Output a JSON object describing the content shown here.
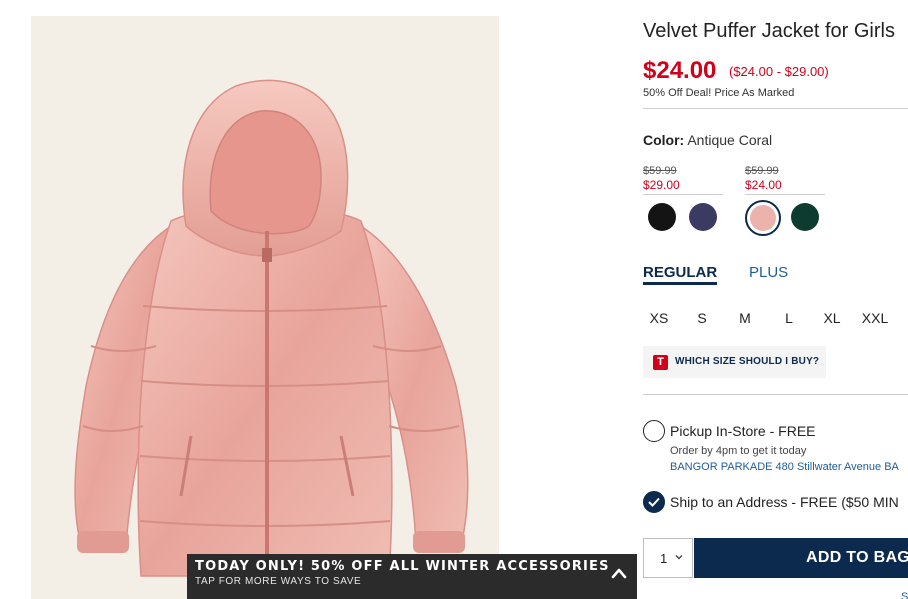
{
  "product": {
    "title": "Velvet Puffer Jacket for Girls",
    "price": "$24.00",
    "price_range": "($24.00 - $29.00)",
    "deal_text": "50% Off Deal! Price As Marked",
    "image_alt": "pink velvet puffer jacket"
  },
  "color": {
    "label": "Color:",
    "selected": "Antique Coral",
    "groups": [
      {
        "was": "$59.99",
        "now": "$29.00"
      },
      {
        "was": "$59.99",
        "now": "$24.00"
      }
    ],
    "swatches": [
      {
        "name": "black",
        "hex": "#141414"
      },
      {
        "name": "navy-plum",
        "hex": "#3a3a62"
      },
      {
        "name": "antique-coral",
        "hex": "#ebb3ab",
        "selected": true
      },
      {
        "name": "emerald",
        "hex": "#0d3b30"
      }
    ]
  },
  "fit_tabs": [
    "REGULAR",
    "PLUS"
  ],
  "sizes": [
    "XS",
    "S",
    "M",
    "L",
    "XL",
    "XXL"
  ],
  "size_guide": {
    "badge": "T",
    "label": "WHICH SIZE SHOULD I BUY?"
  },
  "fulfillment": {
    "pickup_label": "Pickup In-Store - FREE",
    "pickup_sub": "Order by 4pm to get it today",
    "pickup_store": "BANGOR PARKADE 480 Stillwater Avenue  BA",
    "ship_label": "Ship to an Address - FREE ($50 MIN"
  },
  "purchase": {
    "qty": "1",
    "add_to_bag": "ADD TO BAG",
    "corner_link": "S"
  },
  "promo": {
    "title": "TODAY ONLY! 50% OFF ALL WINTER ACCESSORIES",
    "subtitle": "TAP FOR MORE WAYS TO SAVE"
  },
  "colors": {
    "accent": "#0b2a4e",
    "sale": "#d0021b",
    "link": "#1f5d99"
  }
}
